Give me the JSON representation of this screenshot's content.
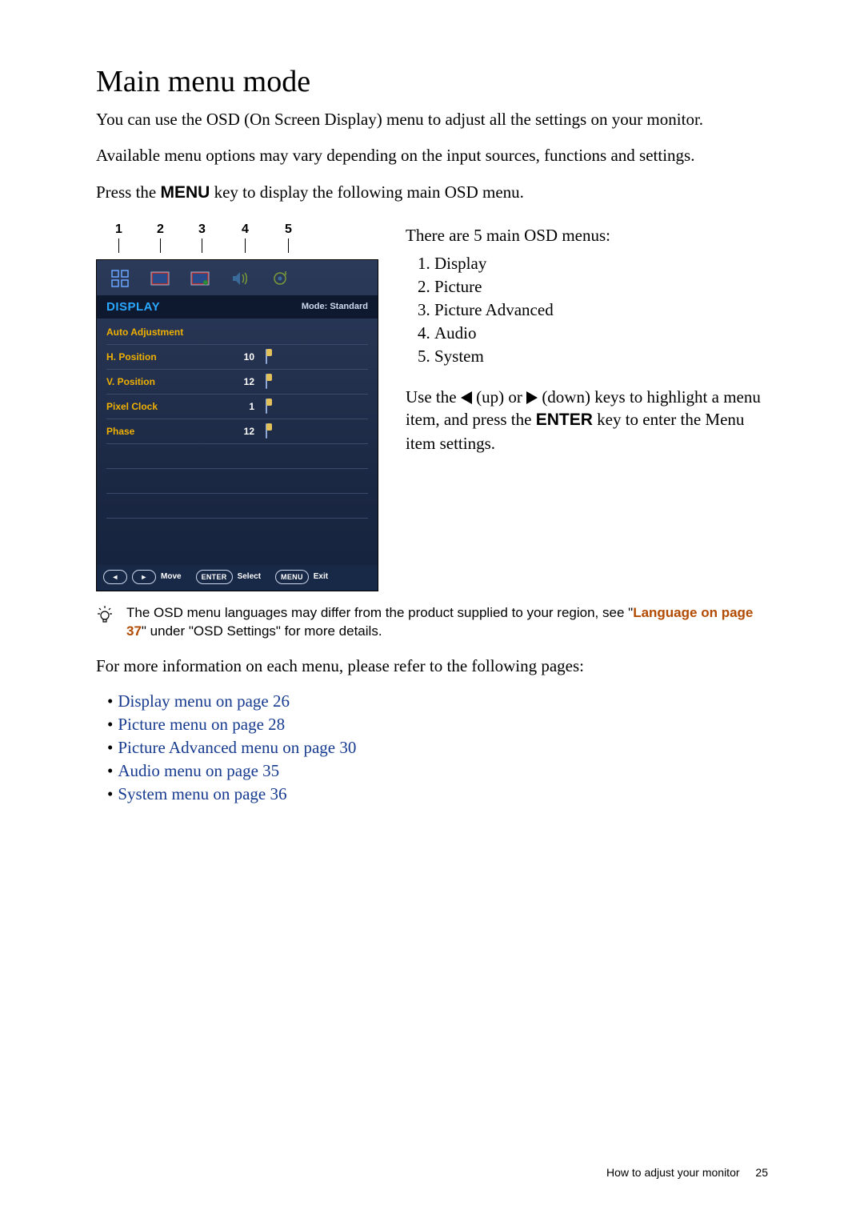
{
  "heading": "Main menu mode",
  "p1": "You can use the OSD (On Screen Display) menu to adjust all the settings on your monitor.",
  "p2": "Available menu options may vary depending on the input sources, functions and settings.",
  "p3_pre": "Press the ",
  "p3_key": "MENU",
  "p3_post": " key to display the following main OSD menu.",
  "callouts": {
    "n1": "1",
    "n2": "2",
    "n3": "3",
    "n4": "4",
    "n5": "5"
  },
  "osd": {
    "title": "DISPLAY",
    "mode": "Mode: Standard",
    "rows": {
      "r0": {
        "label": "Auto Adjustment",
        "value": ""
      },
      "r1": {
        "label": "H. Position",
        "value": "10"
      },
      "r2": {
        "label": "V. Position",
        "value": "12"
      },
      "r3": {
        "label": "Pixel Clock",
        "value": "1"
      },
      "r4": {
        "label": "Phase",
        "value": "12"
      }
    },
    "footer": {
      "moveLeft": "◄",
      "moveRight": "►",
      "move": "Move",
      "enterBtn": "ENTER",
      "select": "Select",
      "menuBtn": "MENU",
      "exit": "Exit"
    }
  },
  "right": {
    "intro": "There are 5 main OSD menus:",
    "items": {
      "i1": "Display",
      "i2": "Picture",
      "i3": "Picture Advanced",
      "i4": "Audio",
      "i5": "System"
    },
    "use_pre": "Use the ",
    "use_up": " (up) or ",
    "use_down": " (down) keys to highlight a menu item, and press the ",
    "enter": "ENTER",
    "use_post": " key to enter the Menu item settings."
  },
  "tip": {
    "t1": "The OSD menu languages may differ from the product supplied to your region, see \"",
    "link": "Language on page 37",
    "t2": "\" under \"OSD Settings\" for more details."
  },
  "more": "For more information on each menu, please refer to the following pages:",
  "links": {
    "l1": "Display menu on page 26",
    "l2": "Picture menu on page 28",
    "l3": "Picture Advanced menu on page 30",
    "l4": "Audio menu on page 35",
    "l5": "System menu on page 36"
  },
  "footer": {
    "section": "How to adjust your monitor",
    "page": "25"
  }
}
